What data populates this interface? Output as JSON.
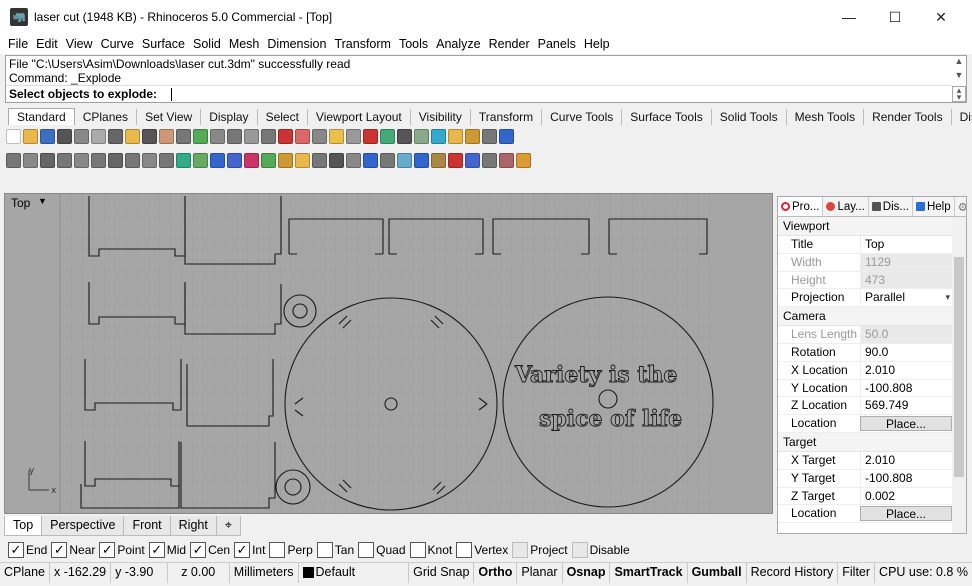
{
  "window": {
    "title": "laser cut (1948 KB) - Rhinoceros 5.0 Commercial - [Top]",
    "minimize": "—",
    "maximize": "☐",
    "close": "✕"
  },
  "menu": [
    "File",
    "Edit",
    "View",
    "Curve",
    "Surface",
    "Solid",
    "Mesh",
    "Dimension",
    "Transform",
    "Tools",
    "Analyze",
    "Render",
    "Panels",
    "Help"
  ],
  "command": {
    "history_1": "File \"C:\\Users\\Asim\\Downloads\\laser cut.3dm\" successfully read",
    "history_2": "Command: _Explode",
    "prompt": "Select objects to explode:",
    "prompt_label": "Select objects to explode"
  },
  "toolbar_tabs": [
    "Standard",
    "CPlanes",
    "Set View",
    "Display",
    "Select",
    "Viewport Layout",
    "Visibility",
    "Transform",
    "Curve Tools",
    "Surface Tools",
    "Solid Tools",
    "Mesh Tools",
    "Render Tools",
    "Di»"
  ],
  "viewport": {
    "name": "Top",
    "text_line_1": "Variety is the",
    "text_line_2": "spice of life",
    "axis_x": "x",
    "axis_y": "y"
  },
  "viewport_tabs": [
    "Top",
    "Perspective",
    "Front",
    "Right",
    "⌖"
  ],
  "osnaps": [
    {
      "label": "End",
      "checked": true
    },
    {
      "label": "Near",
      "checked": true
    },
    {
      "label": "Point",
      "checked": true
    },
    {
      "label": "Mid",
      "checked": true
    },
    {
      "label": "Cen",
      "checked": true
    },
    {
      "label": "Int",
      "checked": true
    },
    {
      "label": "Perp",
      "checked": false
    },
    {
      "label": "Tan",
      "checked": false
    },
    {
      "label": "Quad",
      "checked": false
    },
    {
      "label": "Knot",
      "checked": false
    },
    {
      "label": "Vertex",
      "checked": false
    },
    {
      "label": "Project",
      "checked": false
    },
    {
      "label": "Disable",
      "checked": false
    }
  ],
  "status": {
    "cplane": "CPlane",
    "x": "x -162.29",
    "y": "y -3.90",
    "z": "z 0.00",
    "units": "Millimeters",
    "layer": "Default",
    "grid_snap": "Grid Snap",
    "ortho": "Ortho",
    "planar": "Planar",
    "osnap": "Osnap",
    "smarttrack": "SmartTrack",
    "gumball": "Gumball",
    "record_history": "Record History",
    "filter": "Filter",
    "cpu": "CPU use: 0.8 %"
  },
  "panel": {
    "tabs": [
      "Pro...",
      "Lay...",
      "Dis...",
      "Help"
    ],
    "viewport_section": "Viewport",
    "title_k": "Title",
    "title_v": "Top",
    "width_k": "Width",
    "width_v": "1129",
    "height_k": "Height",
    "height_v": "473",
    "projection_k": "Projection",
    "projection_v": "Parallel",
    "camera_section": "Camera",
    "lens_k": "Lens Length",
    "lens_v": "50.0",
    "rotation_k": "Rotation",
    "rotation_v": "90.0",
    "xloc_k": "X Location",
    "xloc_v": "2.010",
    "yloc_k": "Y Location",
    "yloc_v": "-100.808",
    "zloc_k": "Z Location",
    "zloc_v": "569.749",
    "loc_k": "Location",
    "loc_btn": "Place...",
    "target_section": "Target",
    "xt_k": "X Target",
    "xt_v": "2.010",
    "yt_k": "Y Target",
    "yt_v": "-100.808",
    "zt_k": "Z Target",
    "zt_v": "0.002",
    "tloc_k": "Location",
    "tloc_btn": "Place..."
  }
}
